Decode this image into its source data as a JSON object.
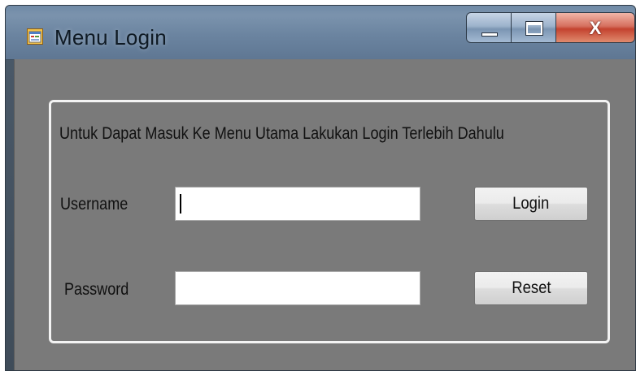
{
  "window": {
    "title": "Menu Login",
    "icon": "form-app-icon",
    "controls": {
      "minimize_icon": "minimize-icon",
      "maximize_icon": "maximize-icon",
      "close_label": "X"
    }
  },
  "form": {
    "info_text": "Untuk Dapat Masuk Ke Menu Utama Lakukan Login Terlebih Dahulu",
    "username": {
      "label": "Username",
      "value": ""
    },
    "password": {
      "label": "Password",
      "value": ""
    },
    "login_label": "Login",
    "reset_label": "Reset"
  },
  "colors": {
    "client_background": "#7a7a7a",
    "groupbox_border": "#f3f3f3",
    "close_button": "#c4432f",
    "titlebar": "#6b84a0"
  }
}
